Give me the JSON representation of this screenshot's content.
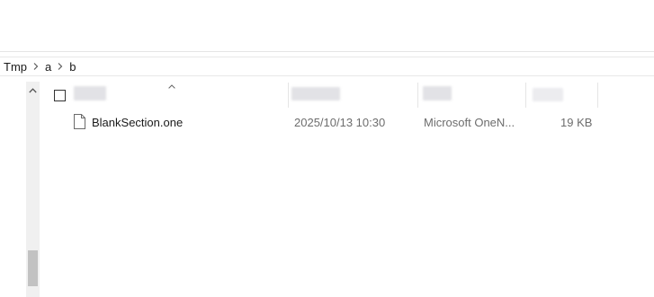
{
  "breadcrumb": {
    "items": [
      "Tmp",
      "a",
      "b"
    ]
  },
  "columns": {
    "sort_indicator": "chevron-up-icon",
    "headers_obscured": true
  },
  "files": [
    {
      "name": "BlankSection.one",
      "date_modified": "2025/10/13 10:30",
      "type": "Microsoft OneN...",
      "size": "19 KB",
      "icon": "document-icon"
    }
  ],
  "colors": {
    "secondary_text": "#6d6d6d",
    "scrollbar_thumb": "#c2c2c2",
    "scrollbar_track": "#f0f0f0"
  }
}
